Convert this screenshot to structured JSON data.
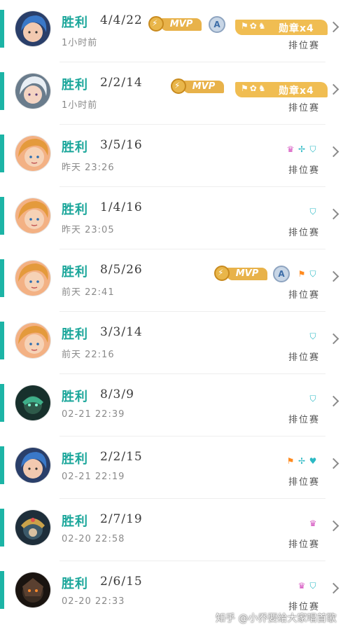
{
  "matches": [
    {
      "result": "胜利",
      "kda": "4/4/22",
      "time": "1小时前",
      "mode": "排位赛",
      "mvp": "MVP",
      "grade": "A",
      "medal": {
        "icons": "⚑✿♞",
        "label": "勋章x4"
      },
      "achievements": [],
      "avatar": "hero-blue-hair"
    },
    {
      "result": "胜利",
      "kda": "2/2/14",
      "time": "1小时前",
      "mode": "排位赛",
      "mvp": "MVP",
      "grade": null,
      "medal": {
        "icons": "⚑✿♞",
        "label": "勋章x4"
      },
      "achievements": [],
      "avatar": "hero-white-hair"
    },
    {
      "result": "胜利",
      "kda": "3/5/16",
      "time": "昨天 23:26",
      "mode": "排位赛",
      "mvp": null,
      "grade": null,
      "medal": null,
      "achievements": [
        {
          "icon": "crown-icon",
          "color": "pink"
        },
        {
          "icon": "bow-icon",
          "color": "teal"
        },
        {
          "icon": "shield-icon",
          "color": "teal"
        }
      ],
      "avatar": "hero-blonde"
    },
    {
      "result": "胜利",
      "kda": "1/4/16",
      "time": "昨天 23:05",
      "mode": "排位赛",
      "mvp": null,
      "grade": null,
      "medal": null,
      "achievements": [
        {
          "icon": "shield-icon",
          "color": "teal"
        }
      ],
      "avatar": "hero-blonde"
    },
    {
      "result": "胜利",
      "kda": "8/5/26",
      "time": "前天 22:41",
      "mode": "排位赛",
      "mvp": "MVP",
      "grade": "A",
      "medal": null,
      "achievements": [
        {
          "icon": "flag-icon",
          "color": "orange"
        },
        {
          "icon": "shield-icon",
          "color": "teal"
        }
      ],
      "avatar": "hero-blonde"
    },
    {
      "result": "胜利",
      "kda": "3/3/14",
      "time": "前天 22:16",
      "mode": "排位赛",
      "mvp": null,
      "grade": null,
      "medal": null,
      "achievements": [
        {
          "icon": "shield-icon",
          "color": "teal"
        }
      ],
      "avatar": "hero-blonde"
    },
    {
      "result": "胜利",
      "kda": "8/3/9",
      "time": "02-21 22:39",
      "mode": "排位赛",
      "mvp": null,
      "grade": null,
      "medal": null,
      "achievements": [
        {
          "icon": "shield-icon",
          "color": "teal"
        }
      ],
      "avatar": "hero-green-mask"
    },
    {
      "result": "胜利",
      "kda": "2/2/15",
      "time": "02-21 22:19",
      "mode": "排位赛",
      "mvp": null,
      "grade": null,
      "medal": null,
      "achievements": [
        {
          "icon": "flag-icon",
          "color": "orange"
        },
        {
          "icon": "bow-icon",
          "color": "teal"
        },
        {
          "icon": "heart-icon",
          "color": "teal"
        }
      ],
      "avatar": "hero-blue-hair"
    },
    {
      "result": "胜利",
      "kda": "2/7/19",
      "time": "02-20 22:58",
      "mode": "排位赛",
      "mvp": null,
      "grade": null,
      "medal": null,
      "achievements": [
        {
          "icon": "crown-icon",
          "color": "pink"
        }
      ],
      "avatar": "hero-ornate-helmet"
    },
    {
      "result": "胜利",
      "kda": "2/6/15",
      "time": "02-20 22:33",
      "mode": "排位赛",
      "mvp": null,
      "grade": null,
      "medal": null,
      "achievements": [
        {
          "icon": "crown-icon",
          "color": "pink"
        },
        {
          "icon": "shield-icon",
          "color": "teal"
        }
      ],
      "avatar": "hero-dark-armor"
    }
  ],
  "watermark": "知乎 @小乔要给大家唱首歌",
  "colors": {
    "accent": "#1cb4a6",
    "mvp": "#e8b24a",
    "medal": "#f0bd52",
    "teal": "#2bb9c4",
    "pink": "#d554c0",
    "orange": "#ff8a1e"
  }
}
